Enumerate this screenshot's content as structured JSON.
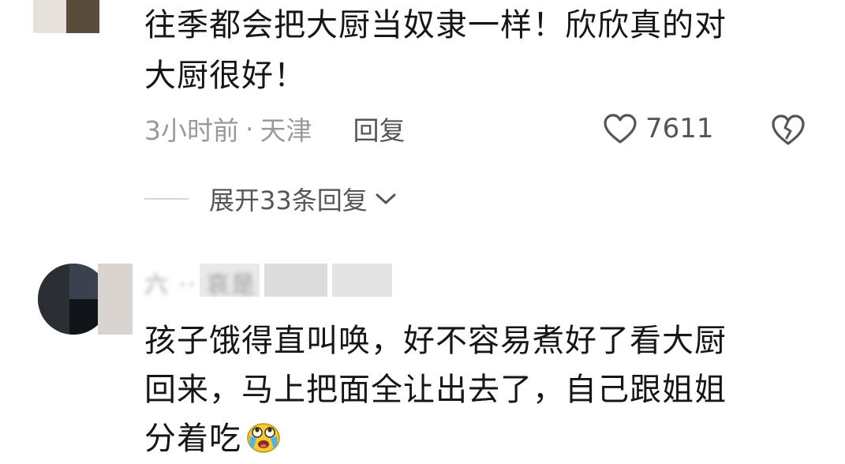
{
  "comment1": {
    "text_lines": [
      "往季都会把大厨当奴隶一样！欣欣真的对",
      "大厨很好！"
    ],
    "time": "3小时前",
    "separator": "·",
    "location": "天津",
    "reply_label": "回复",
    "like_count": "7611",
    "icons": {
      "like": "heart-outline-icon",
      "dislike": "broken-heart-icon"
    }
  },
  "replies": {
    "expand_label": "展开33条回复",
    "icon": "chevron-down-icon"
  },
  "comment2": {
    "username": "六 ·· 哀是",
    "text_lines": [
      "孩子饿得直叫唤，好不容易煮好了看大厨",
      "回来，马上把面全让出去了，自己跟姐姐",
      "分着吃"
    ],
    "emoji": "crying-face-emoji-icon"
  },
  "colors": {
    "text": "#161616",
    "meta": "#9a9a9a",
    "action": "#555555",
    "background": "#ffffff"
  }
}
